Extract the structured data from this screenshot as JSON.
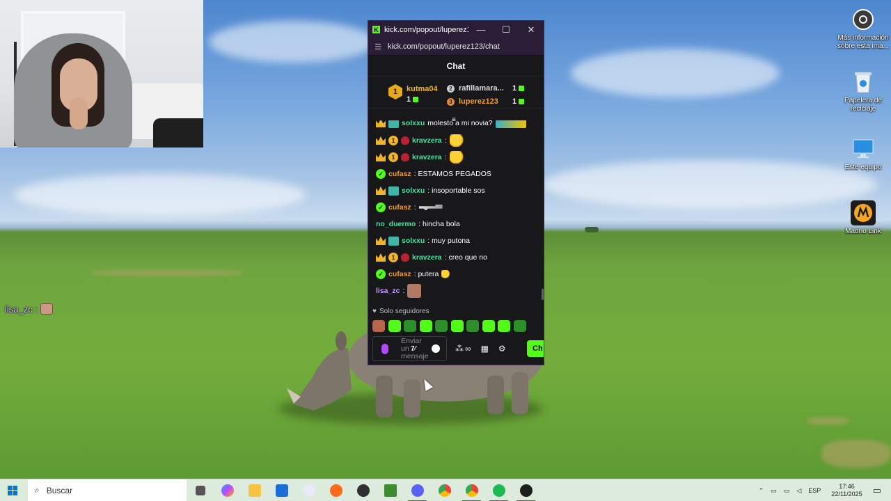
{
  "webcam": {
    "label": "streamer webcam"
  },
  "desktop_chat": {
    "username": "lisa_zc :"
  },
  "desktop_icons": [
    {
      "label": "Más información sobre esta ima...",
      "icon": "camera-info-icon"
    },
    {
      "label": "Papelera de reciclaje",
      "icon": "recycle-bin-icon"
    },
    {
      "label": "Este equipo",
      "icon": "computer-icon"
    },
    {
      "label": "Maono Link",
      "icon": "maono-icon"
    }
  ],
  "popup": {
    "window_title": "kick.com/popout/luperez12...",
    "url": "kick.com/popout/luperez123/chat",
    "chat_title": "Chat",
    "leaderboard": [
      {
        "rank": "1",
        "name": "kutma04",
        "count": "1",
        "color": "#f0b429"
      },
      {
        "rank": "2",
        "name": "rafillamara...",
        "count": "1",
        "color": "#cfcfcf"
      },
      {
        "rank": "3",
        "name": "luperez123",
        "count": "1",
        "color": "#e88b3a"
      }
    ],
    "scroll_indicator": "≡",
    "messages": [
      {
        "user": "solxxu",
        "text": "molesto a mi novia?",
        "user_color": "#4be0a0"
      },
      {
        "user": "kravzera",
        "text": ":",
        "user_color": "#4be0a0"
      },
      {
        "user": "kravzera",
        "text": ":",
        "user_color": "#4be0a0"
      },
      {
        "user": "cufasz",
        "text": ": ESTAMOS PEGADOS",
        "user_color": "#f0a030"
      },
      {
        "user": "solxxu",
        "text": ": insoportable sos",
        "user_color": "#4be0a0"
      },
      {
        "user": "cufasz",
        "text": ":",
        "user_color": "#f0a030"
      },
      {
        "user": "no_duermo",
        "text": ": hincha bola",
        "user_color": "#4be0a0"
      },
      {
        "user": "solxxu",
        "text": ": muy putona",
        "user_color": "#4be0a0"
      },
      {
        "user": "kravzera",
        "text": ": creo que no",
        "user_color": "#4be0a0"
      },
      {
        "user": "cufasz",
        "text": ": putera",
        "user_color": "#f0a030"
      },
      {
        "user": "lisa_zc",
        "text": ":",
        "user_color": "#c59bff"
      }
    ],
    "followers_mode": "Solo seguidores",
    "input_placeholder": "Enviar un mensaje",
    "send_label": "Ch"
  },
  "taskbar": {
    "search_placeholder": "Buscar",
    "language": "ESP",
    "time": "17:46",
    "date": "22/11/2025",
    "apps": [
      "task-view-icon",
      "copilot-icon",
      "file-explorer-icon",
      "store-icon",
      "word-icon",
      "brave-icon",
      "obs-icon",
      "minecraft-icon",
      "discord-icon",
      "chrome-icon",
      "chrome-profile-icon",
      "spotify-icon",
      "app-icon"
    ]
  },
  "colors": {
    "kick_green": "#53fc18",
    "chat_bg": "#18181b"
  }
}
